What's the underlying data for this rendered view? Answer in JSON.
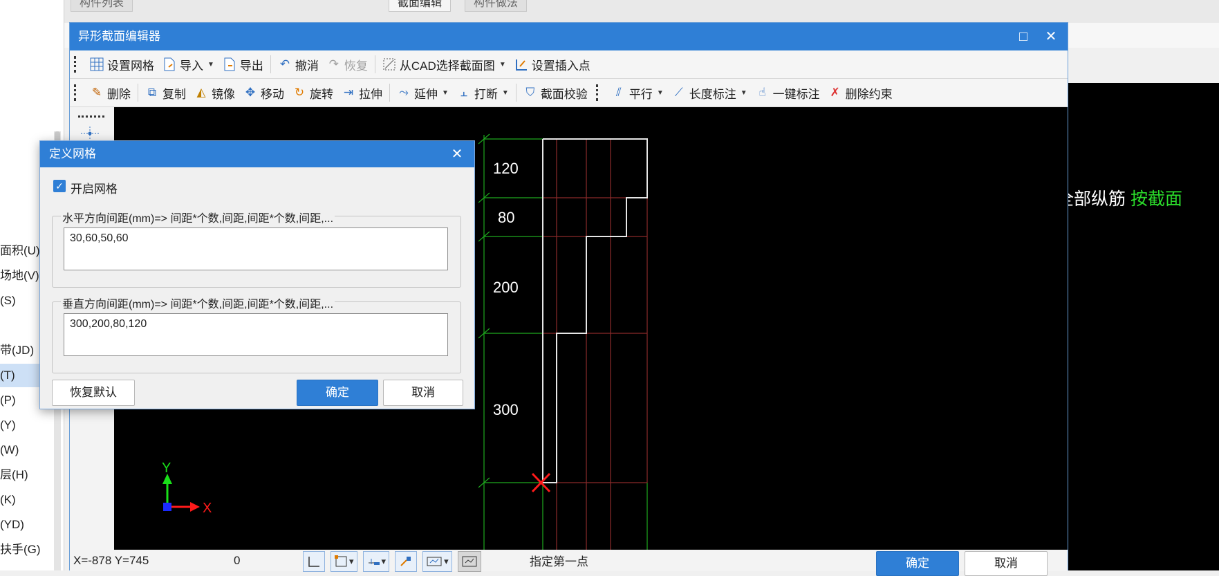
{
  "background": {
    "tabs_left": [
      "构件列表"
    ],
    "tabs_right": [
      "截面编辑",
      "构件做法"
    ],
    "left_items": [
      "面积(U)",
      "场地(V)",
      "(S)",
      "带(JD)",
      "(T)",
      "(P)",
      "(Y)",
      "(W)",
      "层(H)",
      "(K)",
      "(YD)",
      "扶手(G)"
    ],
    "right_text_white": "全部纵筋 ",
    "right_text_green": "按截面"
  },
  "editor": {
    "title": "异形截面编辑器",
    "maximize_icon": "□",
    "close_icon": "✕",
    "toolbar1": {
      "grid": "设置网格",
      "import": "导入",
      "export": "导出",
      "undo": "撤消",
      "redo": "恢复",
      "cad_select": "从CAD选择截面图",
      "insert_point": "设置插入点"
    },
    "toolbar2": {
      "delete": "删除",
      "copy": "复制",
      "mirror": "镜像",
      "move": "移动",
      "rotate": "旋转",
      "stretch": "拉伸",
      "extend": "延伸",
      "break": "打断",
      "verify": "截面校验",
      "parallel": "平行",
      "length_dim": "长度标注",
      "one_key_dim": "一键标注",
      "delete_constraint": "删除约束"
    },
    "canvas": {
      "dims": [
        "120",
        "80",
        "200",
        "300"
      ],
      "axis_x": "X",
      "axis_y": "Y"
    },
    "status": {
      "coords": "X=-878 Y=745",
      "value": "0",
      "prompt": "指定第一点",
      "ok": "确定",
      "cancel": "取消"
    }
  },
  "dialog": {
    "title": "定义网格",
    "close_icon": "✕",
    "enable_grid_label": "开启网格",
    "enable_grid_checked": true,
    "horizontal_label": "水平方向间距(mm)=> 间距*个数,间距,间距*个数,间距,...",
    "horizontal_value": "30,60,50,60",
    "vertical_label": "垂直方向间距(mm)=> 间距*个数,间距,间距*个数,间距,...",
    "vertical_value": "300,200,80,120",
    "restore_default": "恢复默认",
    "ok": "确定",
    "cancel": "取消"
  },
  "colors": {
    "accent": "#2f7fd6",
    "grid_red": "#8b2b2b",
    "grid_green": "#1faa1f",
    "outline": "#e6e6e6",
    "axis_red": "#ff1a1a",
    "axis_green": "#19e019",
    "axis_blue": "#1a2aff"
  }
}
